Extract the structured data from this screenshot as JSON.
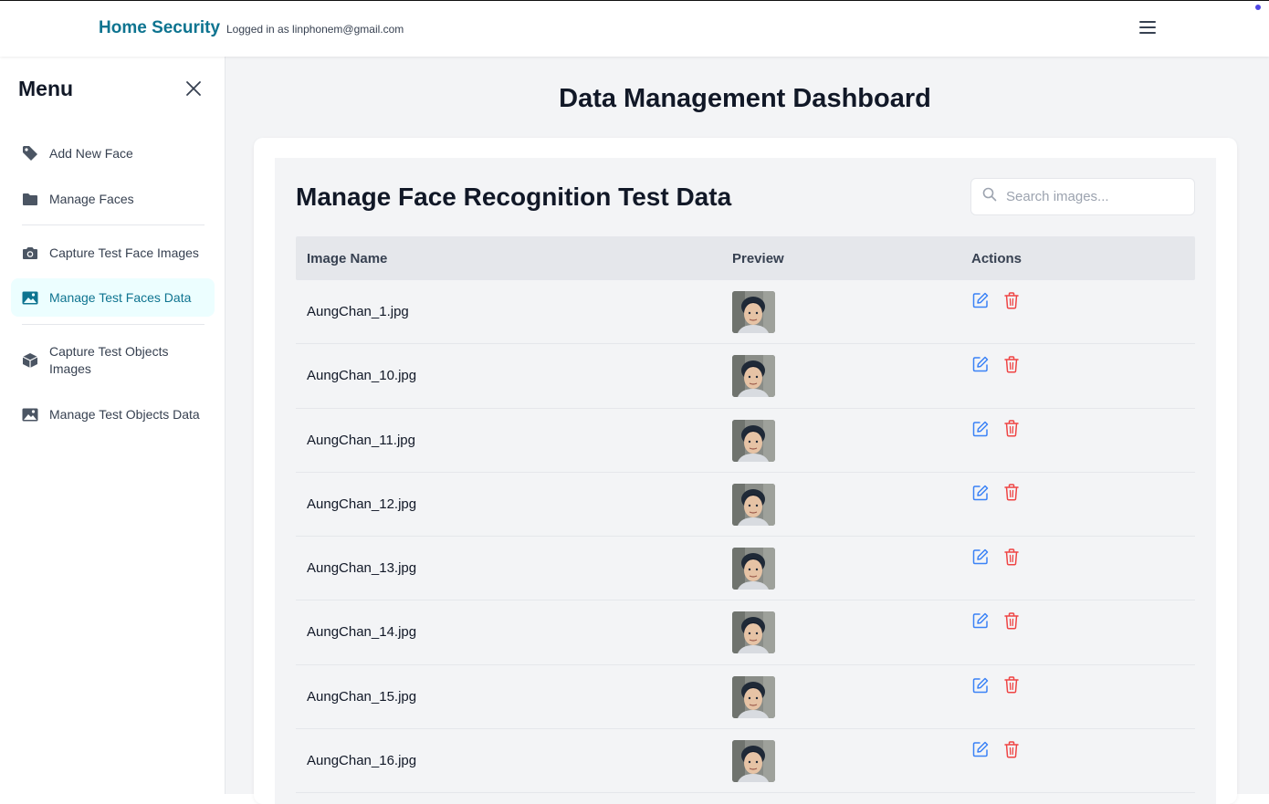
{
  "header": {
    "brand": "Home Security",
    "login_info": "Logged in as linphonem@gmail.com",
    "menu_icon": "hamburger-icon"
  },
  "sidebar": {
    "title": "Menu",
    "close_icon": "close-icon",
    "items": [
      {
        "label": "Add New Face",
        "icon": "tag-icon"
      },
      {
        "label": "Manage Faces",
        "icon": "folder-icon"
      },
      {
        "label": "Capture Test Face Images",
        "icon": "camera-icon"
      },
      {
        "label": "Manage Test Faces Data",
        "icon": "image-icon",
        "active": true
      },
      {
        "label": "Capture Test Objects Images",
        "icon": "cube-icon"
      },
      {
        "label": "Manage Test Objects Data",
        "icon": "image-icon"
      }
    ]
  },
  "main": {
    "page_title": "Data Management Dashboard",
    "section_title": "Manage Face Recognition Test Data",
    "search": {
      "placeholder": "Search images...",
      "value": ""
    },
    "table": {
      "columns": [
        "Image Name",
        "Preview",
        "Actions"
      ],
      "rows": [
        {
          "name": "AungChan_1.jpg"
        },
        {
          "name": "AungChan_10.jpg"
        },
        {
          "name": "AungChan_11.jpg"
        },
        {
          "name": "AungChan_12.jpg"
        },
        {
          "name": "AungChan_13.jpg"
        },
        {
          "name": "AungChan_14.jpg"
        },
        {
          "name": "AungChan_15.jpg"
        },
        {
          "name": "AungChan_16.jpg"
        }
      ]
    }
  },
  "colors": {
    "brand": "#0e7490",
    "edit": "#3b82f6",
    "delete": "#ef4444",
    "active_bg": "#ecfeff"
  }
}
